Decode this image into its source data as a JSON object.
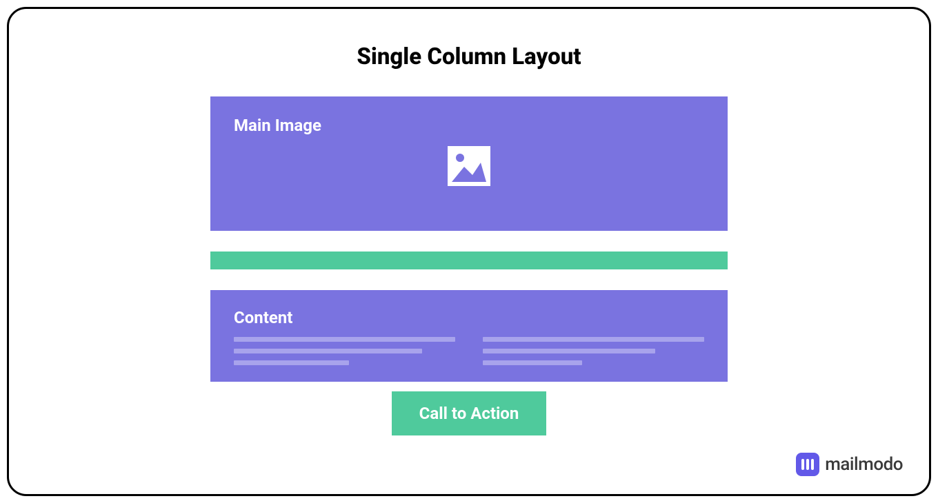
{
  "title": "Single Column Layout",
  "blocks": {
    "main_image_label": "Main Image",
    "content_label": "Content",
    "cta_label": "Call to Action"
  },
  "colors": {
    "purple": "#7A73E0",
    "green": "#4FCA9C",
    "light_purple": "#A8A3EC"
  },
  "brand": {
    "name": "mailmodo"
  }
}
